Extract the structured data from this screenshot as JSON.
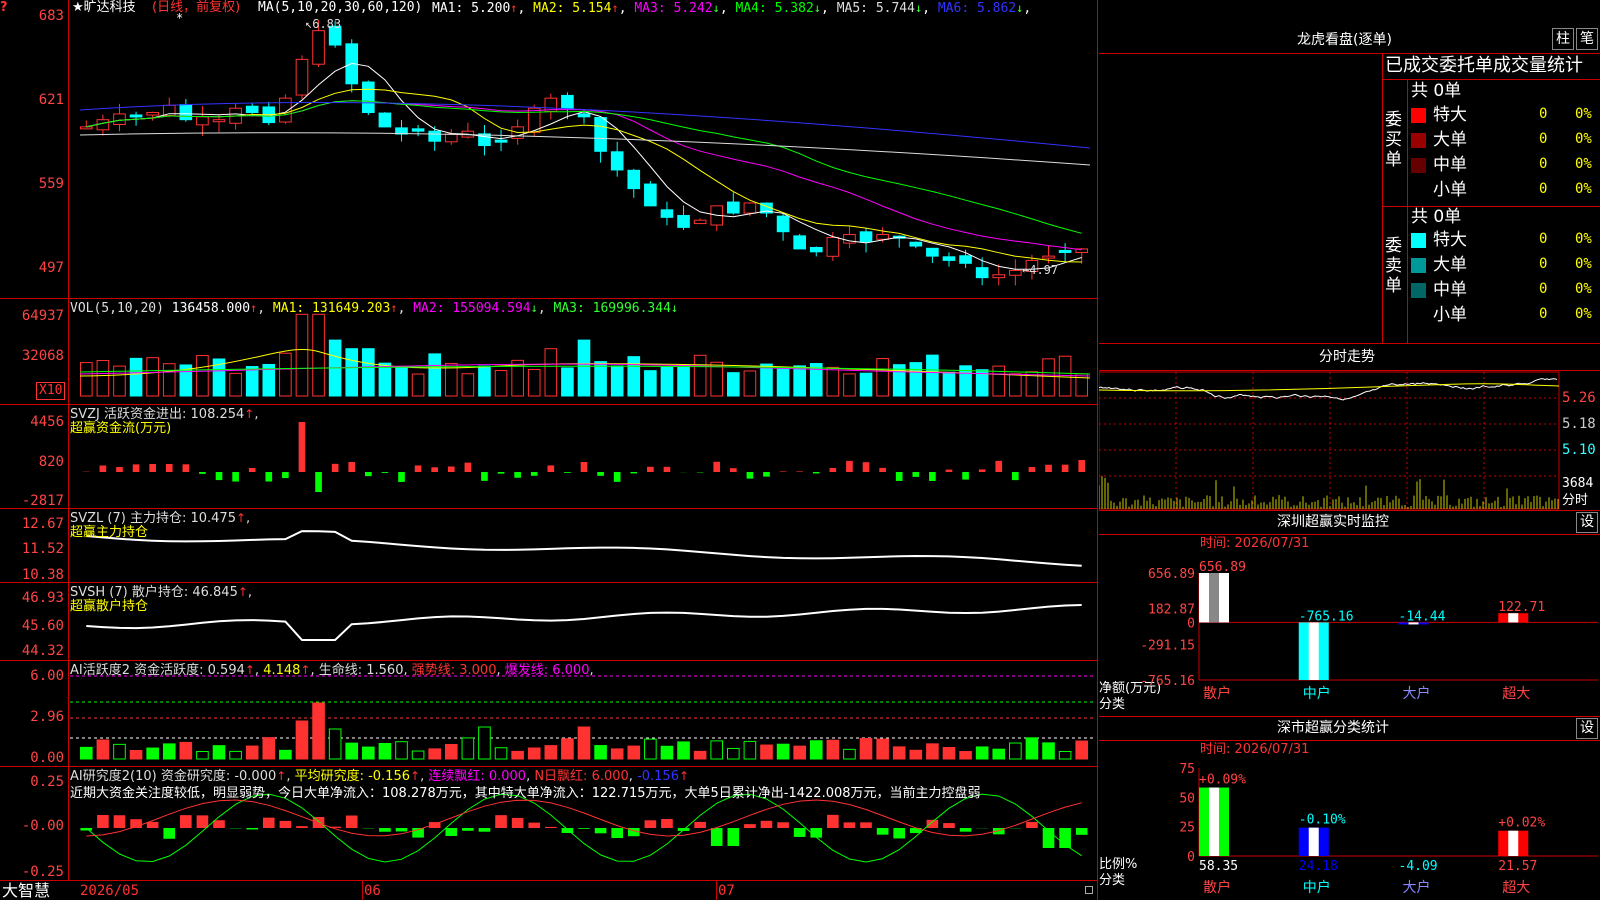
{
  "main": {
    "corner_marker": "?",
    "title_name": "★旷达科技",
    "title_period": "(日线，前复权)",
    "ma_label": "MA(5,10,20,30,60,120)",
    "ma_items": [
      {
        "label": "MA1: 5.200",
        "dir": "↑",
        "color": "#ffffff"
      },
      {
        "label": "MA2: 5.154",
        "dir": "↑",
        "color": "#ffff00"
      },
      {
        "label": "MA3: 5.242",
        "dir": "↓",
        "color": "#ff00ff"
      },
      {
        "label": "MA4: 5.382",
        "dir": "↓",
        "color": "#00ff00"
      },
      {
        "label": "MA5: 5.744",
        "dir": "↓",
        "color": "#dddddd"
      },
      {
        "label": "MA6: 5.862",
        "dir": "↓",
        "color": "#3333ff"
      }
    ],
    "high_note": "6.83",
    "low_note": "←4.97",
    "y_ticks": [
      "683",
      "621",
      "559",
      "497"
    ],
    "y_range": [
      4.9,
      6.85
    ],
    "star_marker": "*"
  },
  "vol": {
    "label": "VOL(5,10,20)",
    "value": "136458.000",
    "ma1": "MA1: 131649.203",
    "ma2": "MA2: 155094.594",
    "ma3": "MA3: 169996.344",
    "y_ticks": [
      "64937",
      "32068"
    ],
    "unit": "X10"
  },
  "svzj": {
    "label": "SVZJ  活跃资金进出: 108.254",
    "sub": "超赢资金流(万元)",
    "y_ticks": [
      "4456",
      "820",
      "-2817"
    ]
  },
  "svzl": {
    "label": "SVZL (7) 主力持仓: 10.475",
    "sub": "超赢主力持仓",
    "y_ticks": [
      "12.67",
      "11.52",
      "10.38"
    ]
  },
  "svsh": {
    "label": "SVSH (7) 散户持仓: 46.845",
    "sub": "超赢散户持仓",
    "y_ticks": [
      "46.93",
      "45.60",
      "44.32"
    ]
  },
  "ai1": {
    "label": "AI活跃度2 资金活跃度: 0.594",
    "v2": "4.148",
    "v3": "生命线: 1.560",
    "v4": "强势线: 3.000",
    "v5": "爆发线: 6.000",
    "y_ticks": [
      "6.00",
      "2.96",
      "0.00"
    ]
  },
  "ai2": {
    "label": "AI研究度2(10) 资金研究度: -0.000",
    "v2": "平均研究度: -0.156",
    "v3": "连续飘红: 0.000",
    "v4": "N日飘红: 6.000",
    "v5": "-0.156",
    "note": "近期大资金关注度较低，明显弱势，今日大单净流入：108.278万元，其中特大单净流入：122.715万元，大单5日累计净出-1422.008万元，当前主力控盘弱",
    "y_ticks": [
      "0.25",
      "-0.00",
      "-0.25"
    ]
  },
  "timeline": {
    "app": "大智慧",
    "dates": [
      "2026/05",
      "06",
      "07"
    ]
  },
  "lhb": {
    "title": "龙虎看盘(逐单)",
    "btn1": "柱",
    "btn2": "笔",
    "header": "已成交委托单成交量统计",
    "buy_label": "委买单",
    "sell_label": "委卖单",
    "buy_total": "共 0单",
    "sell_total": "共 0单",
    "buy_rows": [
      {
        "name": "特大",
        "count": "0",
        "pct": "0%",
        "color": "#ff0000"
      },
      {
        "name": "大单",
        "count": "0",
        "pct": "0%",
        "color": "#990000"
      },
      {
        "name": "中单",
        "count": "0",
        "pct": "0%",
        "color": "#660000"
      },
      {
        "name": "小单",
        "count": "0",
        "pct": "0%",
        "color": "#000000"
      }
    ],
    "sell_rows": [
      {
        "name": "特大",
        "count": "0",
        "pct": "0%",
        "color": "#00ffff"
      },
      {
        "name": "大单",
        "count": "0",
        "pct": "0%",
        "color": "#009999"
      },
      {
        "name": "中单",
        "count": "0",
        "pct": "0%",
        "color": "#006666"
      },
      {
        "name": "小单",
        "count": "0",
        "pct": "0%",
        "color": "#000000"
      }
    ]
  },
  "intraday": {
    "title": "分时走势",
    "y_ticks": [
      "5.26",
      "5.18",
      "5.10"
    ],
    "vol_tick": "3684",
    "vol_label": "分时"
  },
  "sz_monitor": {
    "title": "深圳超赢实时监控",
    "set_btn": "设",
    "time": "时间: 2026/07/31",
    "y_ticks": [
      "656.89",
      "182.87",
      "0",
      "-291.15",
      "-765.16"
    ],
    "ylabel": "净额(万元)",
    "xlabel": "分类",
    "chart_data": {
      "type": "bar",
      "categories": [
        "散户",
        "中户",
        "大户",
        "超大"
      ],
      "values": [
        656.89,
        -765.16,
        -14.44,
        122.71
      ],
      "value_labels": [
        "656.89",
        "-765.16",
        "-14.44",
        "122.71"
      ],
      "ylim": [
        -765.16,
        656.89
      ]
    }
  },
  "sz_stats": {
    "title": "深市超赢分类统计",
    "set_btn": "设",
    "time": "时间: 2026/07/31",
    "y_ticks": [
      "75",
      "50",
      "25",
      "0"
    ],
    "ylabel": "比例%",
    "xlabel": "分类",
    "chart_data": {
      "type": "bar",
      "categories": [
        "散户",
        "中户",
        "大户",
        "超大"
      ],
      "values": [
        58.35,
        24.18,
        -4.09,
        21.57
      ],
      "value_labels": [
        "58.35",
        "24.18",
        "-4.09",
        "21.57"
      ],
      "change_labels": [
        "+0.09%",
        "-0.10%",
        "",
        "+0.02%"
      ],
      "ylim": [
        0,
        75
      ]
    }
  },
  "colors": {
    "up": "#ff3232",
    "down": "#00ffff",
    "grid": "#cc0000"
  }
}
